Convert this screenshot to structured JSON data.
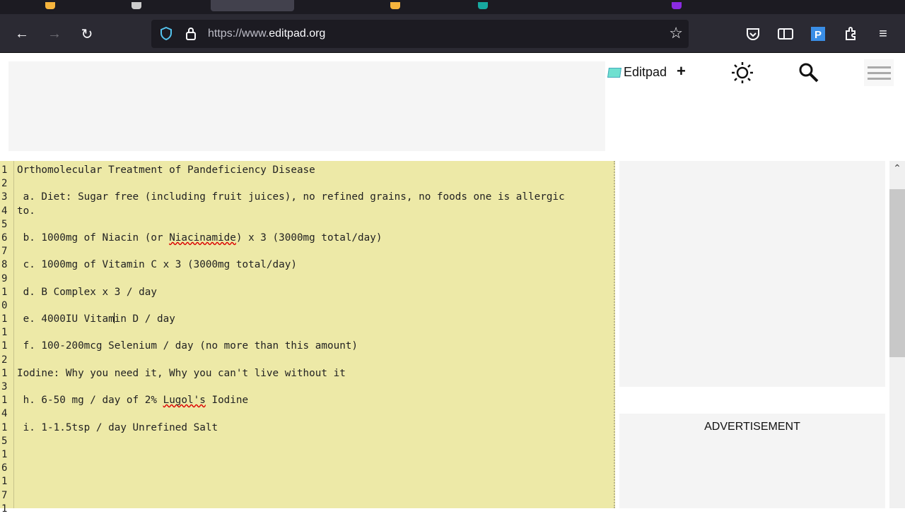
{
  "browser": {
    "url_prefix": "https://www.",
    "url_domain": "editpad.org",
    "tab_icon_colors": [
      "#f5b43d",
      "#cccccc",
      "#cccccc",
      "#f5b43d",
      "#17a9a0",
      "#8a2be2"
    ]
  },
  "header": {
    "logo_text": "Editpad",
    "new_label": "+"
  },
  "editor": {
    "gutter": [
      "1",
      "2",
      "3",
      "4",
      "5",
      "6",
      "7",
      "8",
      "9",
      "1",
      "0",
      "1",
      "1",
      "1",
      "2",
      "1",
      "3",
      "1",
      "4",
      "1",
      "5",
      "1",
      "6",
      "1",
      "7",
      "1"
    ],
    "rows": [
      [
        {
          "t": "Orthomolecular Treatment of Pandeficiency Disease"
        }
      ],
      [],
      [
        {
          "t": " a. Diet: Sugar free (including fruit juices), no refined grains, no foods one is allergic"
        }
      ],
      [
        {
          "t": "to."
        }
      ],
      [],
      [
        {
          "t": " b. 1000mg of Niacin (or "
        },
        {
          "t": "Niacinamide",
          "spell": true
        },
        {
          "t": ") x 3 (3000mg total/day)"
        }
      ],
      [],
      [
        {
          "t": " c. 1000mg of Vitamin C x 3 (3000mg total/day)"
        }
      ],
      [],
      [
        {
          "t": " d. B Complex x 3 / day"
        }
      ],
      [],
      [
        {
          "t": " e. 4000IU Vitam"
        },
        {
          "caret": true
        },
        {
          "t": "in D / day"
        }
      ],
      [],
      [
        {
          "t": " f. 100-200mcg Selenium / day (no more than this amount)"
        }
      ],
      [],
      [
        {
          "t": "Iodine: Why you need it, Why you can't live without it"
        }
      ],
      [],
      [
        {
          "t": " h. 6-50 mg / day of 2% "
        },
        {
          "t": "Lugol's",
          "spell": true
        },
        {
          "t": " Iodine"
        }
      ],
      [],
      [
        {
          "t": " i. 1-1.5tsp / day Unrefined Salt"
        }
      ]
    ]
  },
  "sidebar": {
    "ad_label": "ADVERTISEMENT"
  }
}
